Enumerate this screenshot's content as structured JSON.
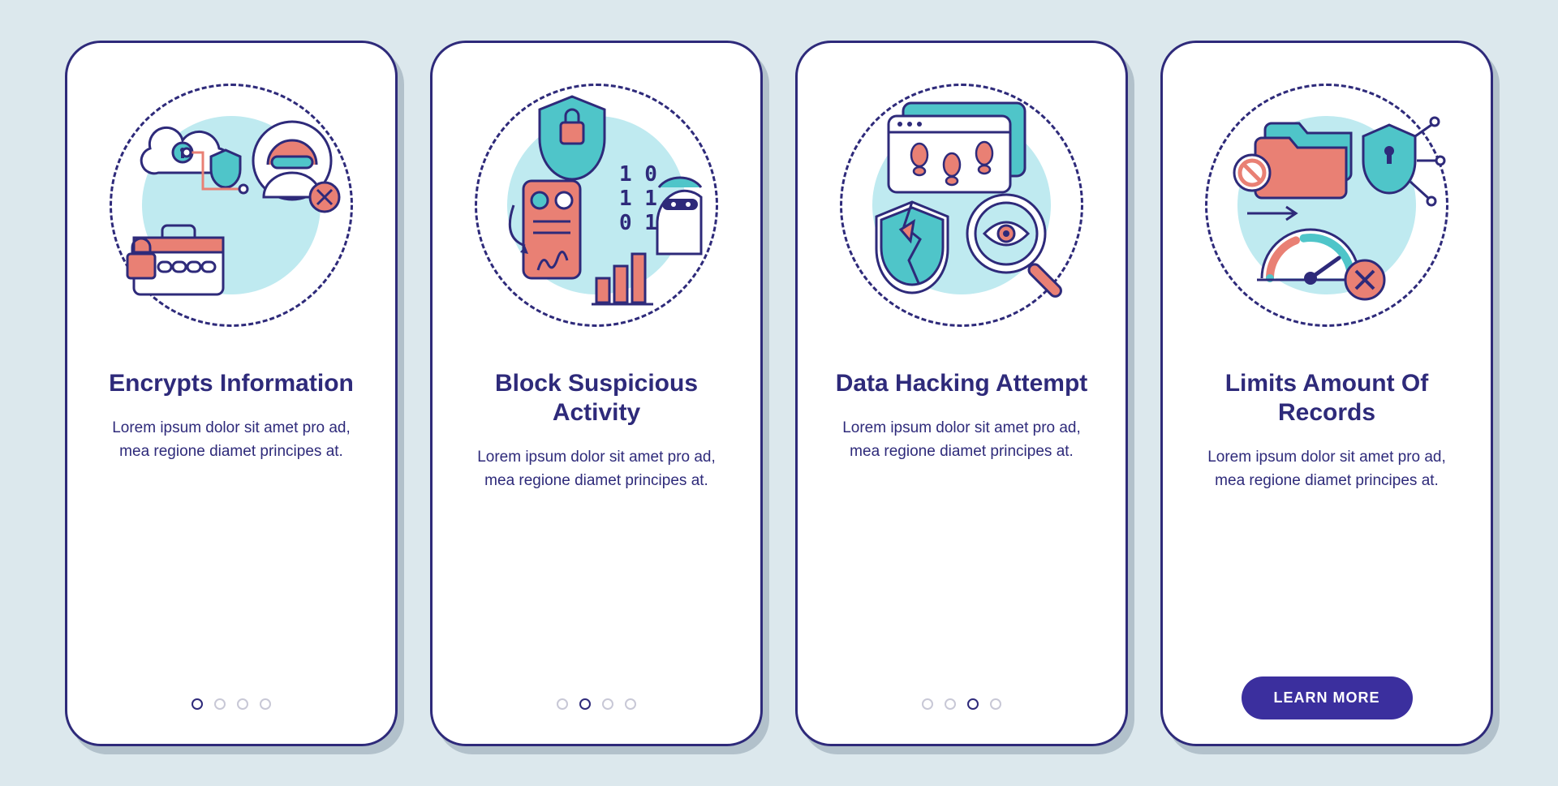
{
  "colors": {
    "ink": "#2e2a7a",
    "teal": "#4fc5c9",
    "tealLight": "#bfeaf0",
    "coral": "#e98074",
    "white": "#ffffff",
    "bg": "#dce8ed",
    "grey": "#c8c8d6"
  },
  "cards": [
    {
      "title": "Encrypts Information",
      "description": "Lorem ipsum dolor sit amet pro ad, mea regione diamet principes at.",
      "icon": "encrypts-icon",
      "activeDot": 0,
      "hasButton": false
    },
    {
      "title": "Block Suspicious Activity",
      "description": "Lorem ipsum dolor sit amet pro ad, mea regione diamet principes at.",
      "icon": "block-suspicious-icon",
      "activeDot": 1,
      "hasButton": false
    },
    {
      "title": "Data Hacking Attempt",
      "description": "Lorem ipsum dolor sit amet pro ad, mea regione diamet principes at.",
      "icon": "data-hacking-icon",
      "activeDot": 2,
      "hasButton": false
    },
    {
      "title": "Limits Amount Of Records",
      "description": "Lorem ipsum dolor sit amet pro ad, mea regione diamet principes at.",
      "icon": "limits-records-icon",
      "activeDot": 3,
      "hasButton": true
    }
  ],
  "buttonLabel": "LEARN MORE",
  "totalDots": 4
}
